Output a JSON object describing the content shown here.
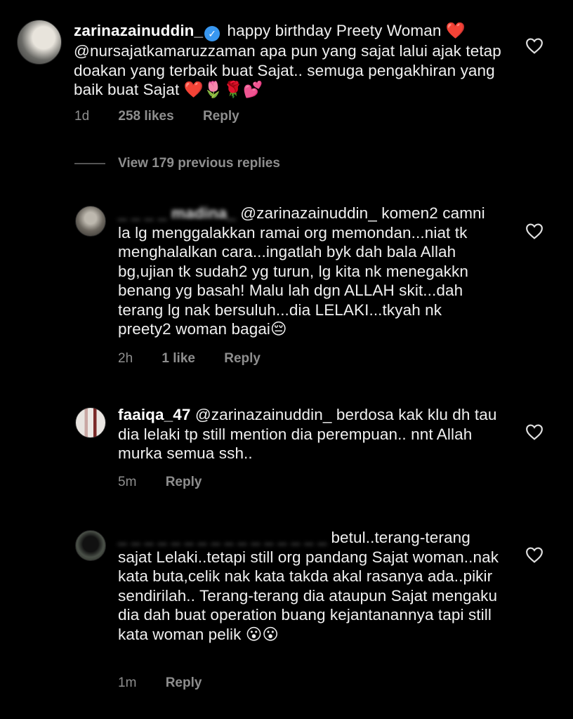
{
  "comments": [
    {
      "username": "zarinazainuddin_",
      "verified": true,
      "text_before_mention": "happy birthday Preety Woman",
      "emoji_1": "❤️",
      "mention": "@nursajatkamaruzzaman",
      "text_after_mention": " apa pun yang sajat lalui ajak tetap doakan yang terbaik buat Sajat.. semuga pengakhiran yang baik buat Sajat",
      "emoji_2": "❤️🌷🌹💕",
      "time": "1d",
      "likes": "258 likes",
      "reply": "Reply"
    },
    {
      "username": "_ _ _ _ madina_",
      "mention": "@zarinazainuddin_",
      "text": " komen2 camni la lg menggalakkan ramai org memondan...niat tk menghalalkan cara...ingatlah byk dah bala Allah bg,ujian tk sudah2 yg turun, lg kita nk menegakkn benang yg basah! Malu lah dgn ALLAH skit...dah terang lg nak bersuluh...dia LELAKI...tkyah nk preety2 woman bagai",
      "emoji": "😔",
      "time": "2h",
      "likes": "1 like",
      "reply": "Reply"
    },
    {
      "username": "faaiqa_47",
      "mention": "@zarinazainuddin_",
      "text": " berdosa kak klu dh tau dia lelaki tp still mention dia perempuan.. nnt Allah murka semua ssh..",
      "time": "5m",
      "reply": "Reply"
    },
    {
      "username": "_ _ _ _ _ _ _ _ _ _ _ _ _ _ _ _",
      "text": " betul..terang-terang sajat Lelaki..tetapi still org pandang Sajat woman..nak kata buta,celik nak kata takda akal rasanya ada..pikir sendirilah.. Terang-terang dia ataupun Sajat mengaku dia dah buat operation buang kejantanannya tapi still kata woman pelik",
      "emoji": "😮😮",
      "time": "1m",
      "reply": "Reply"
    }
  ],
  "view_replies": "View 179 previous replies",
  "colors": {
    "background": "#000000",
    "text": "#f0f0f0",
    "muted": "#8e8e8e",
    "verified": "#3897f0"
  },
  "icons": [
    "heart-outline-icon",
    "verified-badge-icon",
    "avatar"
  ]
}
